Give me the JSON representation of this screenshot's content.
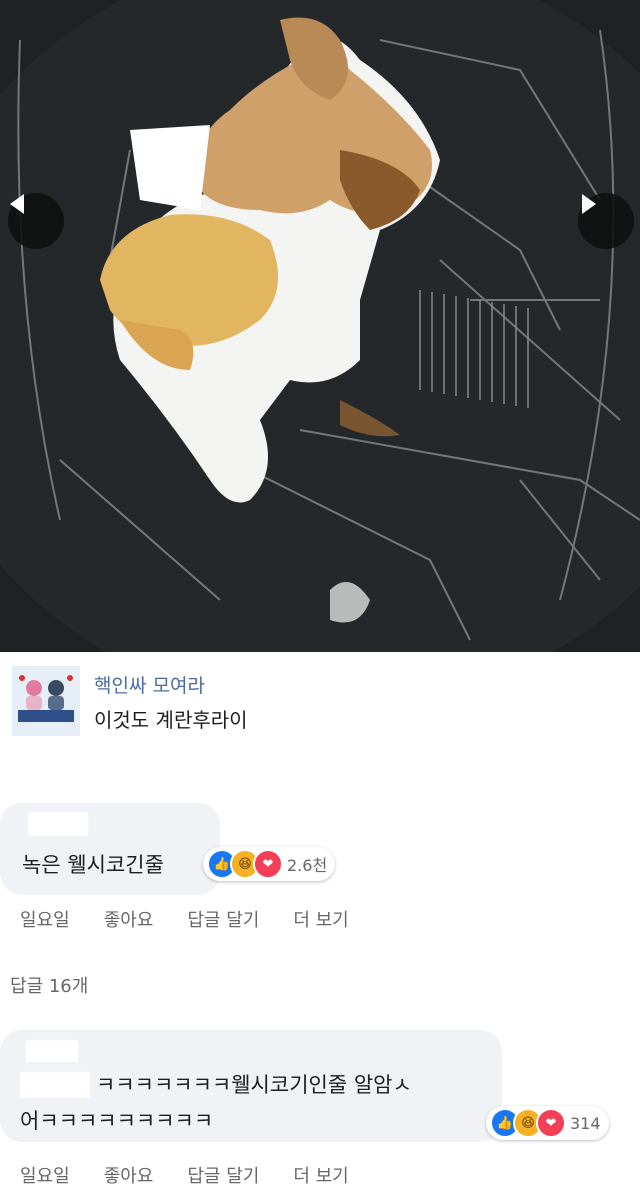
{
  "photo": {
    "prev_icon": "chevron-left-icon",
    "next_icon": "chevron-right-icon",
    "description_colors": {
      "pan": "#1f2224",
      "egg_white": "#f4f4f2",
      "yolk": "#e2b560",
      "crust": "#8a5a2c"
    }
  },
  "post": {
    "group_name": "핵인싸 모여라",
    "avatar_caption": "핵인싸모여라",
    "text": "이것도 계란후라이"
  },
  "comments": [
    {
      "text_lines": [
        "녹은 웰시코긴줄"
      ],
      "reactions": [
        "like",
        "haha",
        "love"
      ],
      "reaction_count": "2.6천",
      "actions": [
        "일요일",
        "좋아요",
        "답글 달기",
        "더 보기"
      ]
    },
    {
      "text_lines": [
        "ㅋㅋㅋㅋㅋㅋㅋ웰시코기인줄 알암ㅅ",
        "어ㅋㅋㅋㅋㅋㅋㅋㅋㅋ"
      ],
      "reactions": [
        "like",
        "haha",
        "love"
      ],
      "reaction_count": "314",
      "actions": [
        "일요일",
        "좋아요",
        "답글 달기",
        "더 보기"
      ]
    }
  ],
  "replies_label": "답글 16개"
}
